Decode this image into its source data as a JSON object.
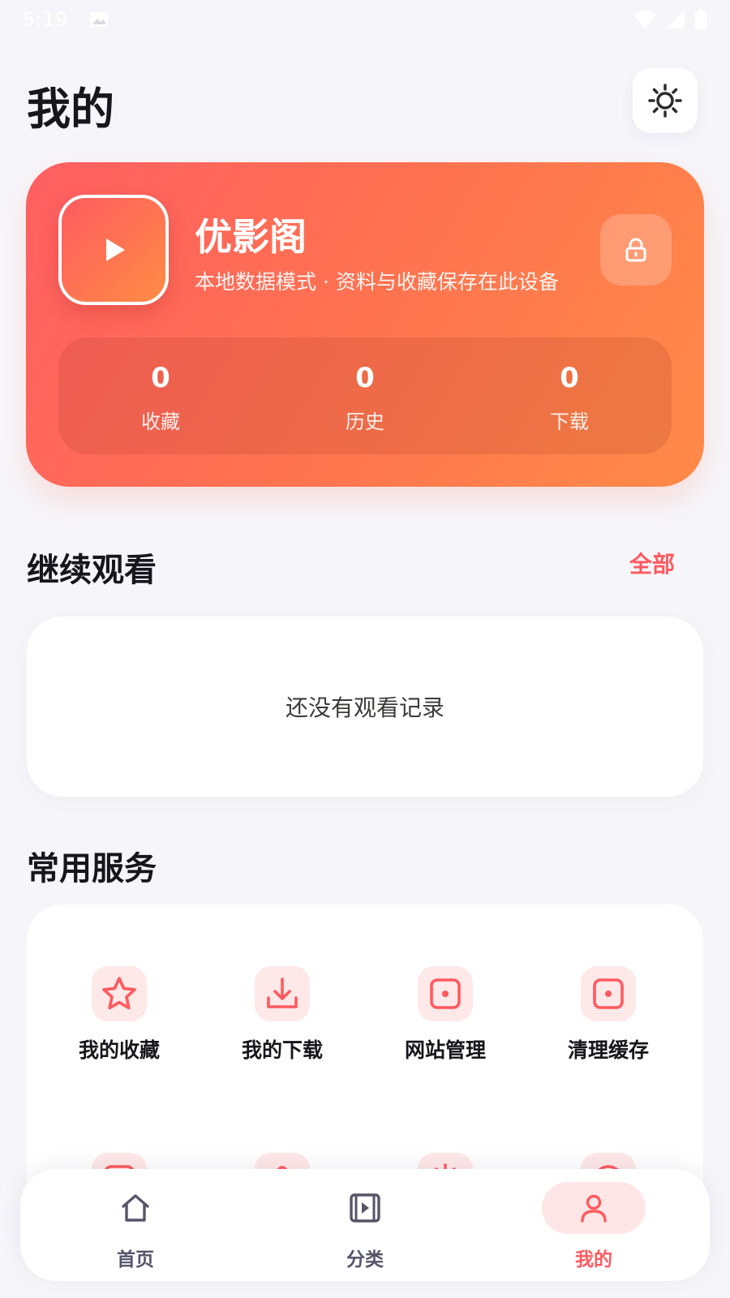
{
  "status_bar": {
    "time": "5:19",
    "icons": [
      "image-icon",
      "wifi-icon",
      "signal-icon",
      "battery-icon"
    ]
  },
  "header": {
    "title": "我的",
    "theme_icon": "sun-icon"
  },
  "profile": {
    "app_name": "优影阁",
    "subtitle": "本地数据模式 · 资料与收藏保存在此设备",
    "logo_icon": "play-icon",
    "lock_icon": "lock-icon",
    "stats": [
      {
        "value": "0",
        "label": "收藏"
      },
      {
        "value": "0",
        "label": "历史"
      },
      {
        "value": "0",
        "label": "下载"
      }
    ]
  },
  "continue_watching": {
    "title": "继续观看",
    "see_all": "全部",
    "empty_text": "还没有观看记录"
  },
  "services": {
    "title": "常用服务",
    "items": [
      {
        "label": "我的收藏",
        "icon": "star-icon"
      },
      {
        "label": "我的下载",
        "icon": "download-icon"
      },
      {
        "label": "网站管理",
        "icon": "square-dot-icon"
      },
      {
        "label": "清理缓存",
        "icon": "square-dot-icon"
      }
    ]
  },
  "bottom_nav": {
    "items": [
      {
        "label": "首页",
        "icon": "home-icon",
        "active": false
      },
      {
        "label": "分类",
        "icon": "video-icon",
        "active": false
      },
      {
        "label": "我的",
        "icon": "user-icon",
        "active": true
      }
    ]
  },
  "colors": {
    "accent": "#ff5a5f",
    "gradient_start": "#ff5e62",
    "gradient_end": "#ff8a48",
    "background": "#f6f6fa"
  }
}
